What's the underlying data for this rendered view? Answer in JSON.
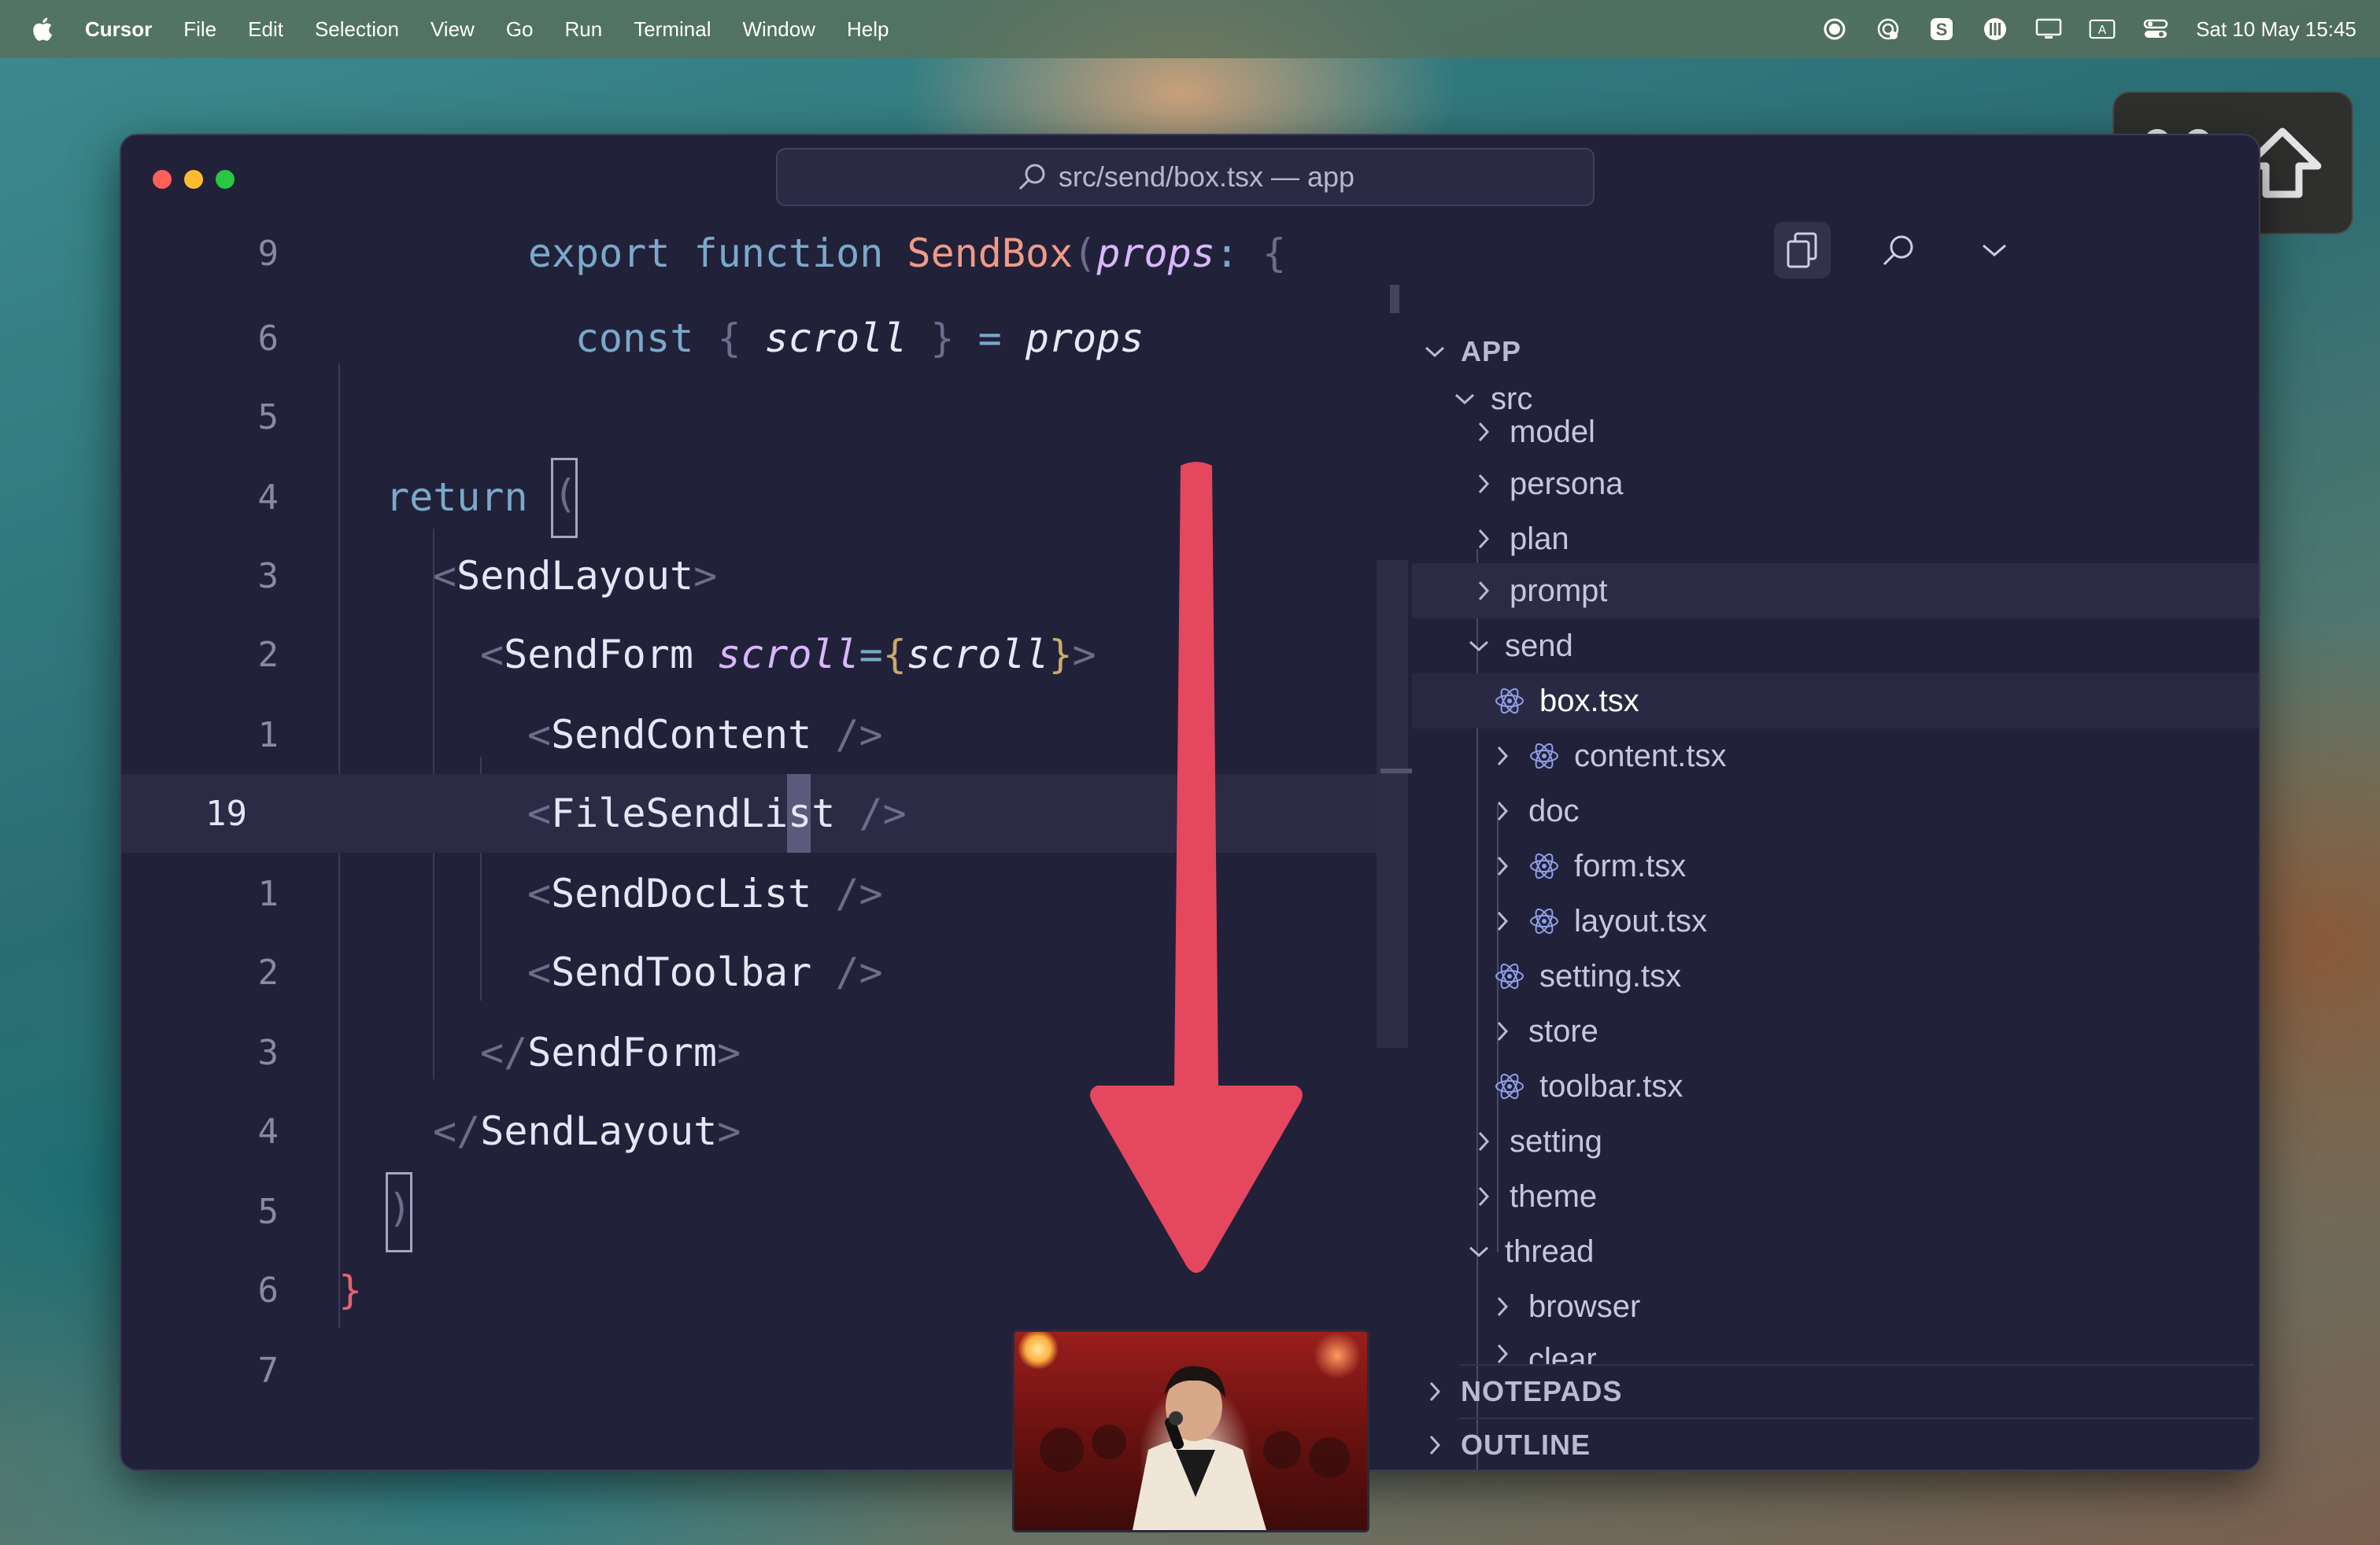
{
  "menubar": {
    "items": [
      "Cursor",
      "File",
      "Edit",
      "Selection",
      "View",
      "Go",
      "Run",
      "Terminal",
      "Window",
      "Help"
    ],
    "clock": "Sat 10 May  15:45"
  },
  "window": {
    "title": "src/send/box.tsx — app"
  },
  "editor": {
    "line_numbers": [
      "9",
      "6",
      "5",
      "4",
      "3",
      "2",
      "1",
      "19",
      "1",
      "2",
      "3",
      "4",
      "5",
      "6",
      "7"
    ],
    "current_line": "19",
    "code": {
      "l1": [
        "export",
        " function ",
        "SendBox",
        "(",
        "props",
        ": ",
        "{"
      ],
      "l2": [
        "const",
        " { ",
        "scroll",
        " } ",
        "= ",
        "props"
      ],
      "l4": [
        "return"
      ],
      "l5": [
        "<",
        "SendLayout",
        ">"
      ],
      "l6": [
        "<",
        "SendForm ",
        "scroll",
        "=",
        "{",
        "scroll",
        "}",
        ">"
      ],
      "l7": [
        "<",
        "SendContent",
        " />"
      ],
      "l8": [
        "<",
        "FileSendList",
        " />"
      ],
      "l9": [
        "<",
        "SendDocList",
        " />"
      ],
      "l10": [
        "<",
        "SendToolbar",
        " />"
      ],
      "l11": [
        "</",
        "SendForm",
        ">"
      ],
      "l12": [
        "</",
        "SendLayout",
        ">"
      ],
      "l4_paren": "(",
      "l13": ")",
      "l14": "}"
    }
  },
  "explorer": {
    "sections": {
      "app": "APP",
      "notepads": "NOTEPADS",
      "outline": "OUTLINE"
    },
    "items": [
      "src",
      "model",
      "persona",
      "plan",
      "prompt",
      "send",
      "box.tsx",
      "content.tsx",
      "doc",
      "form.tsx",
      "layout.tsx",
      "setting.tsx",
      "store",
      "toolbar.tsx",
      "setting",
      "theme",
      "thread",
      "browser",
      "clear"
    ]
  },
  "keystroke_overlay": {
    "keys": [
      "cmd-key-icon",
      "shift-key-icon"
    ]
  },
  "colors": {
    "window_bg": "#22213a",
    "arrow": "#e5475e",
    "accent_keyword": "#7aa9c9",
    "accent_function": "#f09a87"
  }
}
